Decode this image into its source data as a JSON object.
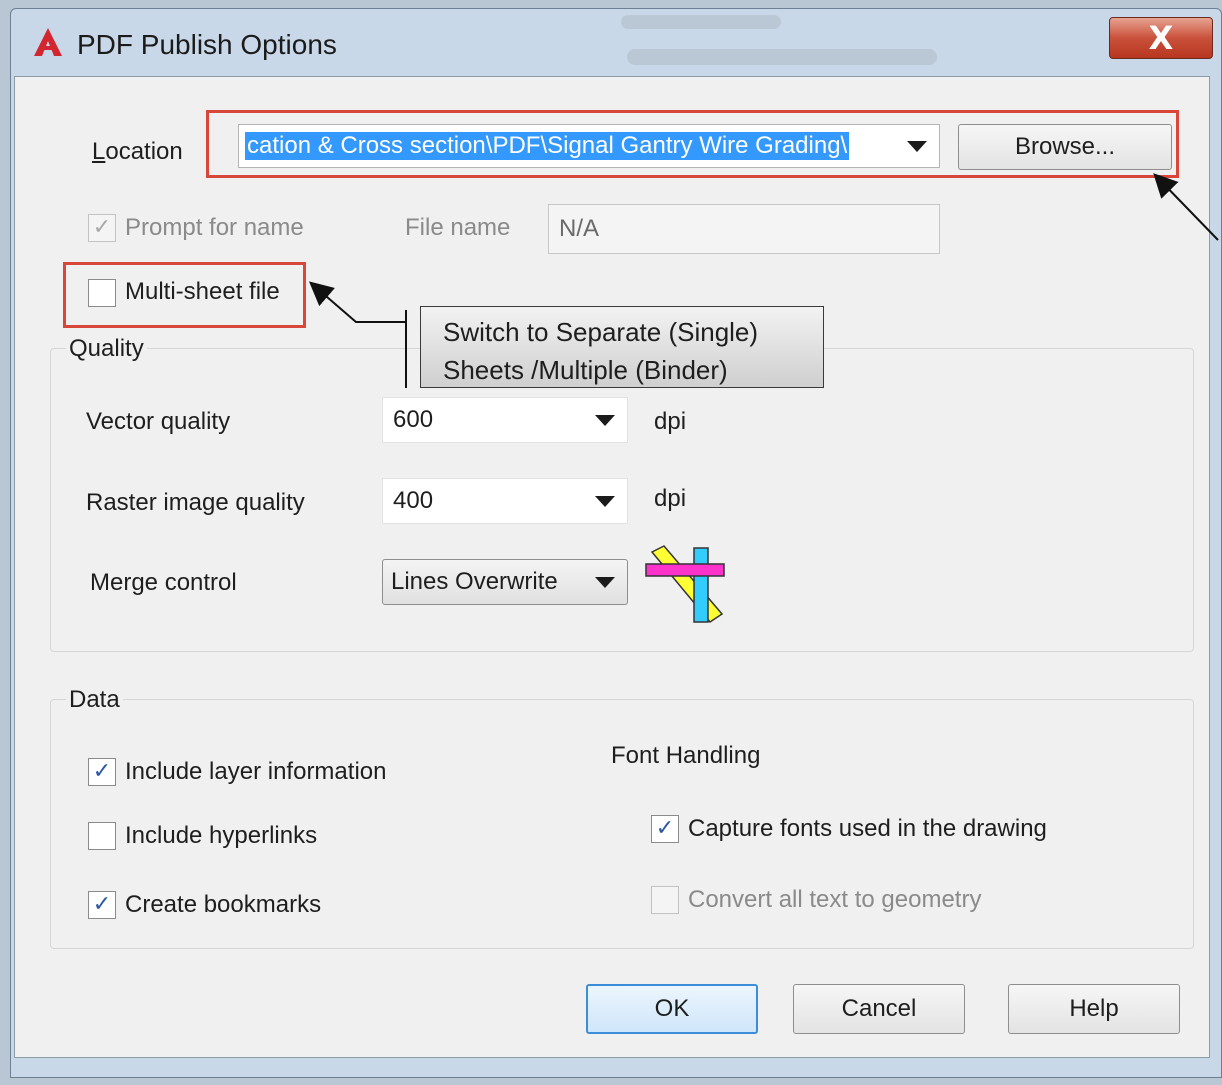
{
  "window": {
    "title": "PDF Publish Options",
    "close_label": "X"
  },
  "location": {
    "label": "Location",
    "value": "cation & Cross section\\PDF\\Signal Gantry Wire Grading\\",
    "browse_label": "Browse..."
  },
  "prompt_for_name": {
    "label": "Prompt for name",
    "checked": true,
    "enabled": false
  },
  "file_name": {
    "label": "File name",
    "value": "N/A"
  },
  "multi_sheet": {
    "label": "Multi-sheet file",
    "checked": false
  },
  "annotation": {
    "line1": "Switch to Separate (Single)",
    "line2": "Sheets /Multiple (Binder)"
  },
  "quality": {
    "title": "Quality",
    "vector_label": "Vector quality",
    "vector_value": "600",
    "raster_label": "Raster image quality",
    "raster_value": "400",
    "unit": "dpi",
    "merge_label": "Merge control",
    "merge_value": "Lines Overwrite",
    "merge_icon": "lines-overwrite-preview-icon"
  },
  "data": {
    "title": "Data",
    "include_layer": {
      "label": "Include layer information",
      "checked": true
    },
    "include_hyperlinks": {
      "label": "Include hyperlinks",
      "checked": false
    },
    "create_bookmarks": {
      "label": "Create bookmarks",
      "checked": true
    }
  },
  "font_handling": {
    "title": "Font Handling",
    "capture_fonts": {
      "label": "Capture fonts used in the drawing",
      "checked": true
    },
    "convert_text": {
      "label": "Convert all text to geometry",
      "checked": false,
      "enabled": false
    }
  },
  "buttons": {
    "ok": "OK",
    "cancel": "Cancel",
    "help": "Help"
  },
  "colors": {
    "highlight": "#d9473a",
    "selection": "#3399ff",
    "close": "#c9513b"
  }
}
